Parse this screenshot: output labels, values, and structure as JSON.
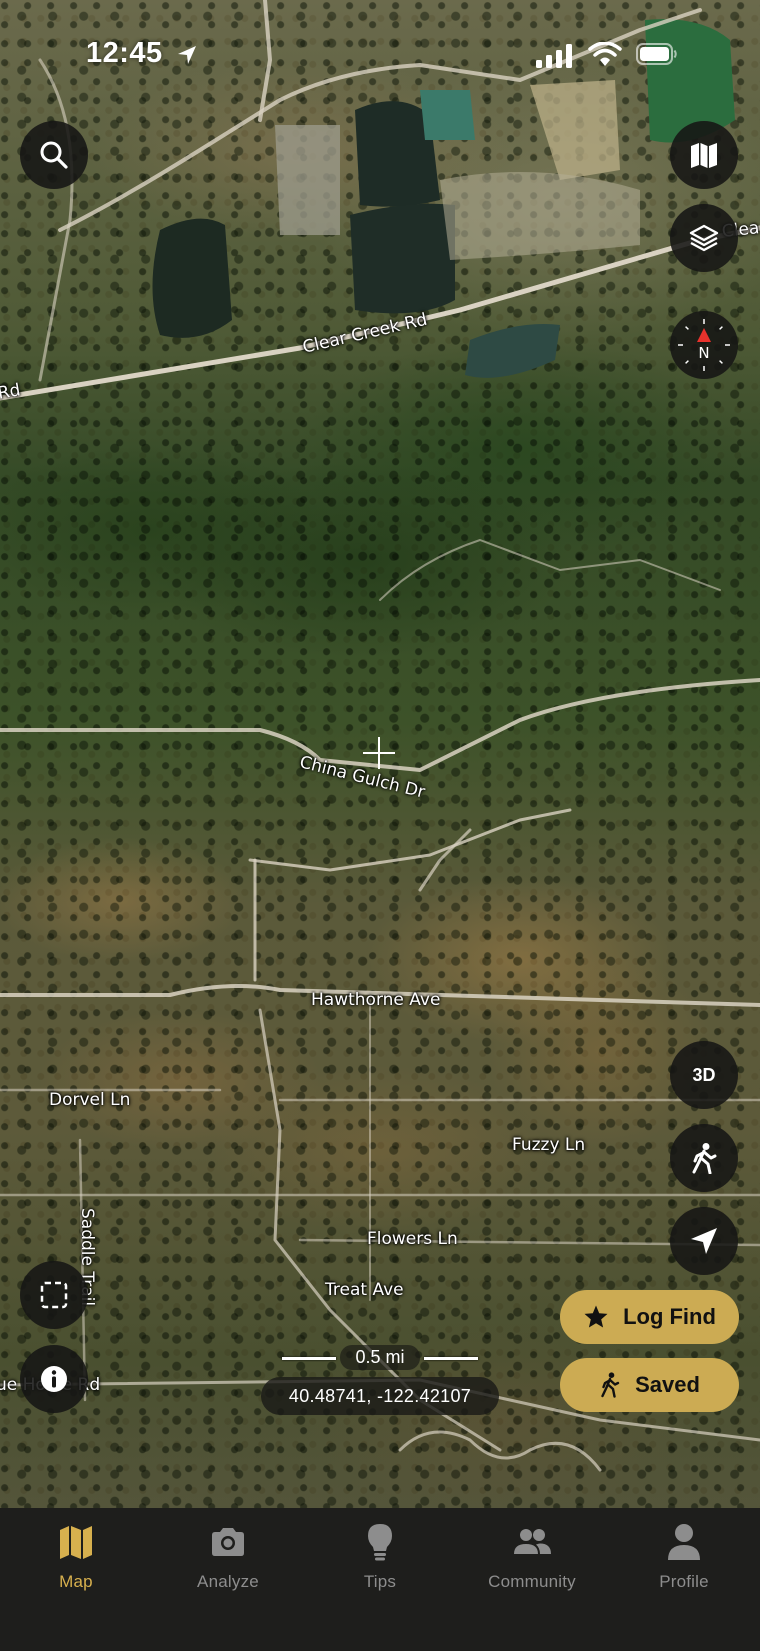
{
  "status_bar": {
    "time": "12:45"
  },
  "map": {
    "road_labels": {
      "clear_creek": "Clear Creek Rd",
      "clear_creek_edge": "Clea",
      "rd_left": "Rd",
      "china_gulch": "China Gulch Dr",
      "hawthorne": "Hawthorne Ave",
      "dorvel": "Dorvel Ln",
      "fuzzy": "Fuzzy Ln",
      "saddle_trail": "Saddle Trail",
      "flowers": "Flowers Ln",
      "treat": "Treat Ave",
      "horse_rd": "ue Horse Rd"
    },
    "scale": "0.5 mi",
    "coordinates": "40.48741, -122.42107"
  },
  "controls": {
    "three_d": "3D",
    "icons": {
      "search": "search-icon",
      "map_style": "map-icon",
      "layers": "layers-icon",
      "compass": "compass-icon",
      "walk": "walking-icon",
      "locate": "location-arrow-icon",
      "select_area": "selection-icon",
      "info": "info-icon"
    }
  },
  "actions": {
    "log_find": "Log Find",
    "saved": "Saved"
  },
  "tabs": [
    {
      "label": "Map",
      "icon": "map-icon",
      "active": true
    },
    {
      "label": "Analyze",
      "icon": "camera-icon",
      "active": false
    },
    {
      "label": "Tips",
      "icon": "lightbulb-icon",
      "active": false
    },
    {
      "label": "Community",
      "icon": "people-icon",
      "active": false
    },
    {
      "label": "Profile",
      "icon": "person-icon",
      "active": false
    }
  ],
  "colors": {
    "accent": "#ccab53",
    "tab_active": "#d7b04e",
    "tab_inactive": "#8d8d8d",
    "tab_bar_bg": "#1e1e1c",
    "button_bg": "#161614"
  }
}
